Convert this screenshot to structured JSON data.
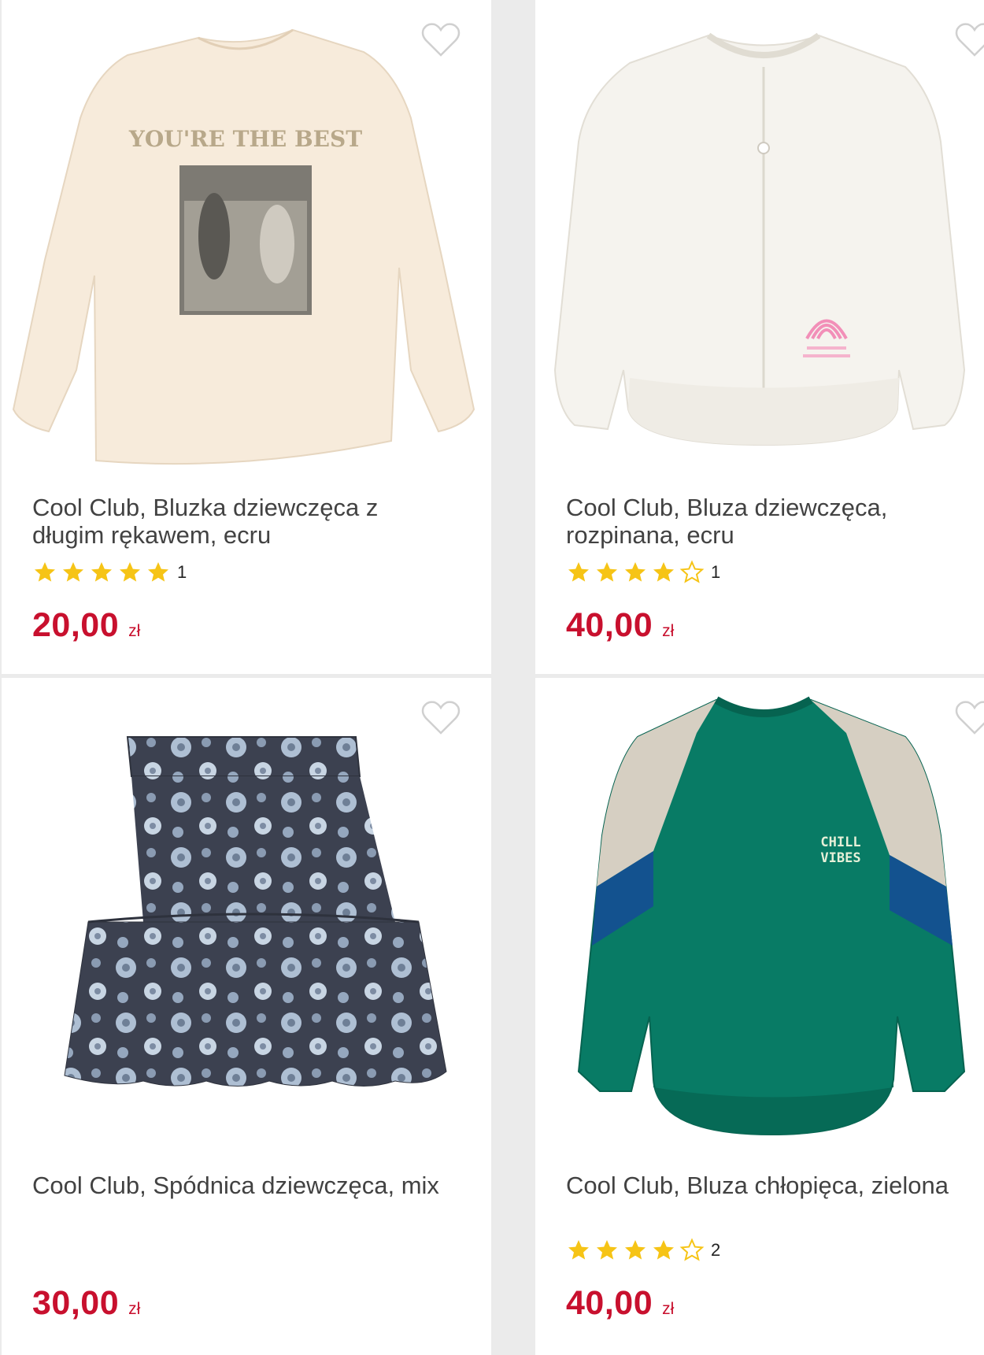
{
  "colors": {
    "price": "#c8102e",
    "star_filled": "#f6c416",
    "star_empty": "#f6c416",
    "title": "#424242",
    "background": "#ebebeb"
  },
  "products": [
    {
      "title": "Cool Club, Bluzka dziewczęca z długim rękawem, ecru",
      "rating": 5,
      "rating_count": "1",
      "price": "20,00",
      "currency": "zł",
      "print_text": "YOU'RE THE BEST"
    },
    {
      "title": "Cool Club, Bluza dziewczęca, rozpinana, ecru",
      "rating": 4,
      "rating_count": "1",
      "price": "40,00",
      "currency": "zł"
    },
    {
      "title": "Cool Club, Spódnica dziewczęca, mix",
      "rating": null,
      "rating_count": "",
      "price": "30,00",
      "currency": "zł"
    },
    {
      "title": "Cool Club, Bluza chłopięca, zielona",
      "rating": 4,
      "rating_count": "2",
      "price": "40,00",
      "currency": "zł",
      "print_text_line1": "CHILL",
      "print_text_line2": "VIBES"
    }
  ],
  "icons": {
    "favorite": "heart-outline-icon",
    "star": "star-icon"
  }
}
